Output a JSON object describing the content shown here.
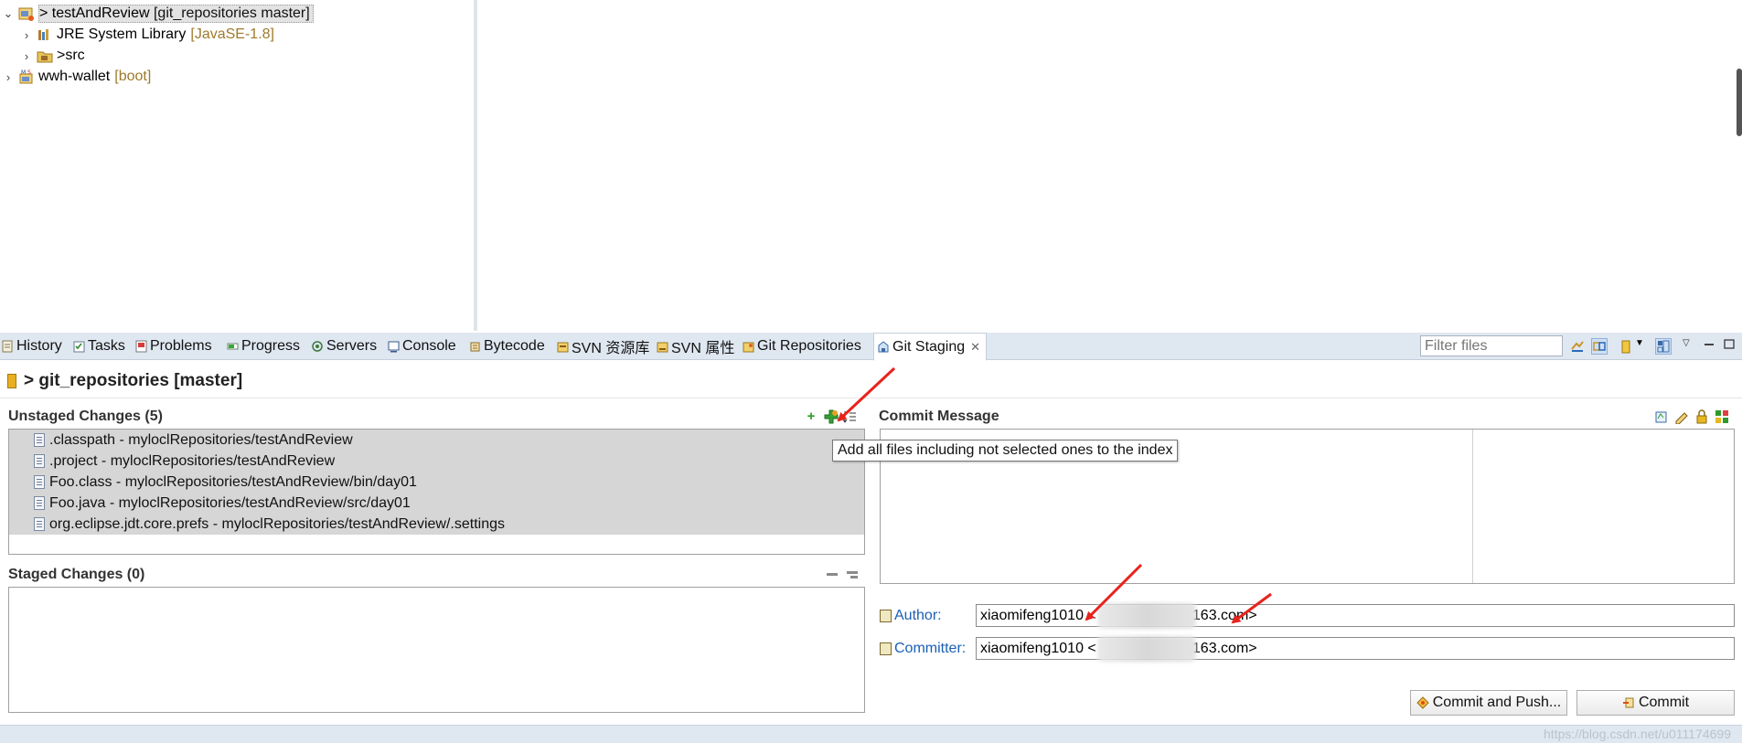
{
  "explorer": {
    "items": [
      {
        "prefix": "> ",
        "label": "testAndReview",
        "decoration": "[git_repositories master]",
        "expanded": true
      },
      {
        "label": "JRE System Library",
        "decoration": "[JavaSE-1.8]"
      },
      {
        "prefix": "> ",
        "label": "src",
        "decoration": ""
      },
      {
        "label": "wwh-wallet",
        "decoration": "[boot]"
      }
    ]
  },
  "tabs": [
    {
      "label": "History"
    },
    {
      "label": "Tasks"
    },
    {
      "label": "Problems"
    },
    {
      "label": "Progress"
    },
    {
      "label": "Servers"
    },
    {
      "label": "Console"
    },
    {
      "label": "Bytecode"
    },
    {
      "label": "SVN 资源库"
    },
    {
      "label": "SVN 属性"
    },
    {
      "label": "Git Repositories"
    },
    {
      "label": "Git Staging",
      "active": true
    }
  ],
  "filter": {
    "placeholder": "Filter files"
  },
  "staging": {
    "repo_title": "> git_repositories [master]",
    "unstaged": {
      "title": "Unstaged Changes (5)",
      "files": [
        ".classpath - myloclRepositories/testAndReview",
        ".project - myloclRepositories/testAndReview",
        "Foo.class - myloclRepositories/testAndReview/bin/day01",
        "Foo.java - myloclRepositories/testAndReview/src/day01",
        "org.eclipse.jdt.core.prefs - myloclRepositories/testAndReview/.settings"
      ]
    },
    "staged": {
      "title": "Staged Changes (0)",
      "files": []
    },
    "tooltip": "Add all files including not selected ones to the index",
    "commit_message": {
      "title": "Commit Message",
      "value": ""
    },
    "author": {
      "label": "Author:",
      "value": "xiaomifeng1010 <                    @163.com>"
    },
    "committer": {
      "label": "Committer:",
      "value": "xiaomifeng1010 <                    @163.com>"
    },
    "buttons": {
      "commit_and_push": "Commit and Push...",
      "commit": "Commit"
    }
  },
  "status": {
    "watermark": "https://blog.csdn.net/u011174699"
  },
  "colors": {
    "accent_link": "#1a5fb4",
    "tabbar": "#dfe7f1",
    "annotation_arrow": "#e8231c"
  }
}
